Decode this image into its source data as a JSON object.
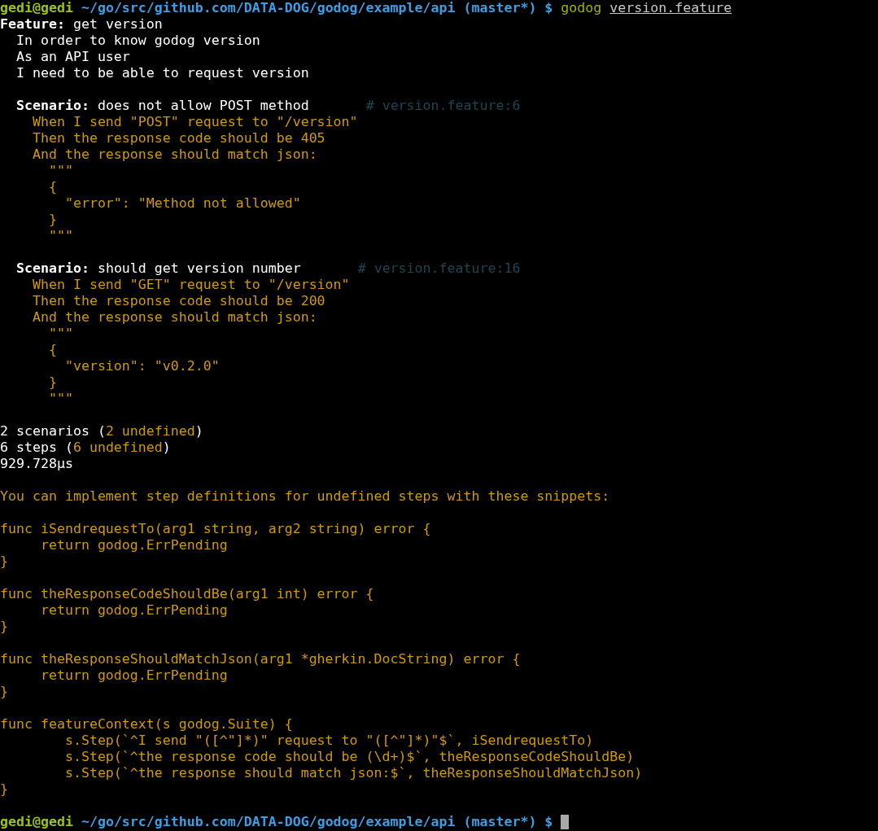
{
  "terminal": {
    "lines": [
      {
        "kind": "text",
        "segments": [
          {
            "kind": "user",
            "text": "gedi@gedi"
          },
          {
            "kind": "path",
            "text": "~/go/src/github.com/DATA-DOG/godog/example/api (master*) $"
          },
          {
            "kind": "command",
            "text": "godog"
          },
          {
            "kind": "argument",
            "text": "version.feature"
          }
        ]
      },
      {
        "kind": "text",
        "segments": [
          {
            "kind": "heading",
            "text": "**Feature:** get version"
          }
        ]
      },
      {
        "kind": "text",
        "segments": [
          {
            "kind": "plain",
            "text": "  In order to know godog version"
          }
        ]
      },
      {
        "kind": "text",
        "segments": [
          {
            "kind": "plain",
            "text": "  As an API user"
          }
        ]
      },
      {
        "kind": "text",
        "segments": [
          {
            "kind": "plain",
            "text": "  I need to be able to request version"
          }
        ]
      },
      {
        "kind": "blank"
      },
      {
        "kind": "text",
        "segments": [
          {
            "kind": "heading",
            "text": "  **Scenario:** does not allow POST method"
          },
          {
            "kind": "comment",
            "text": "# version.feature:6"
          }
        ]
      },
      {
        "kind": "text",
        "segments": [
          {
            "kind": "step",
            "text": "    When I send \"POST\" request to \"/version\""
          }
        ]
      },
      {
        "kind": "text",
        "segments": [
          {
            "kind": "step",
            "text": "    Then the response code should be 405"
          }
        ]
      },
      {
        "kind": "text",
        "segments": [
          {
            "kind": "step",
            "text": "    And the response should match json:"
          }
        ]
      },
      {
        "kind": "text",
        "segments": [
          {
            "kind": "step",
            "text": "      \"\"\""
          }
        ]
      },
      {
        "kind": "text",
        "segments": [
          {
            "kind": "step",
            "text": "      {"
          }
        ]
      },
      {
        "kind": "text",
        "segments": [
          {
            "kind": "step",
            "text": "        \"error\": \"Method not allowed\""
          }
        ]
      },
      {
        "kind": "text",
        "segments": [
          {
            "kind": "step",
            "text": "      }"
          }
        ]
      },
      {
        "kind": "text",
        "segments": [
          {
            "kind": "step",
            "text": "      \"\"\""
          }
        ]
      },
      {
        "kind": "blank"
      },
      {
        "kind": "text",
        "segments": [
          {
            "kind": "heading",
            "text": "  **Scenario:** should get version number"
          },
          {
            "kind": "comment",
            "text": "# version.feature:16"
          }
        ]
      },
      {
        "kind": "text",
        "segments": [
          {
            "kind": "step",
            "text": "    When I send \"GET\" request to \"/version\""
          }
        ]
      },
      {
        "kind": "text",
        "segments": [
          {
            "kind": "step",
            "text": "    Then the response code should be 200"
          }
        ]
      },
      {
        "kind": "text",
        "segments": [
          {
            "kind": "step",
            "text": "    And the response should match json:"
          }
        ]
      },
      {
        "kind": "text",
        "segments": [
          {
            "kind": "step",
            "text": "      \"\"\""
          }
        ]
      },
      {
        "kind": "text",
        "segments": [
          {
            "kind": "step",
            "text": "      {"
          }
        ]
      },
      {
        "kind": "text",
        "segments": [
          {
            "kind": "step",
            "text": "        \"version\": \"v0.2.0\""
          }
        ]
      },
      {
        "kind": "text",
        "segments": [
          {
            "kind": "step",
            "text": "      }"
          }
        ]
      },
      {
        "kind": "text",
        "segments": [
          {
            "kind": "step",
            "text": "      \"\"\""
          }
        ]
      },
      {
        "kind": "blank"
      },
      {
        "kind": "text",
        "segments": [
          {
            "kind": "plain",
            "text": "2 scenarios ("
          },
          {
            "kind": "undefined",
            "text": "2 undefined"
          },
          {
            "kind": "plain",
            "text": ")"
          }
        ]
      },
      {
        "kind": "text",
        "segments": [
          {
            "kind": "plain",
            "text": "6 steps ("
          },
          {
            "kind": "undefined",
            "text": "6 undefined"
          },
          {
            "kind": "plain",
            "text": ")"
          }
        ]
      },
      {
        "kind": "text",
        "segments": [
          {
            "kind": "plain",
            "text": "929.728µs"
          }
        ]
      },
      {
        "kind": "blank"
      },
      {
        "kind": "text",
        "segments": [
          {
            "kind": "snippet",
            "text": "You can implement step definitions for undefined steps with these snippets:"
          }
        ]
      },
      {
        "kind": "blank"
      },
      {
        "kind": "text",
        "segments": [
          {
            "kind": "snippet",
            "text": "func iSendrequestTo(arg1 string, arg2 string) error {"
          }
        ]
      },
      {
        "kind": "text",
        "segments": [
          {
            "kind": "snippet",
            "text": "     return godog.ErrPending"
          }
        ]
      },
      {
        "kind": "text",
        "segments": [
          {
            "kind": "snippet",
            "text": "}"
          }
        ]
      },
      {
        "kind": "blank"
      },
      {
        "kind": "text",
        "segments": [
          {
            "kind": "snippet",
            "text": "func theResponseCodeShouldBe(arg1 int) error {"
          }
        ]
      },
      {
        "kind": "text",
        "segments": [
          {
            "kind": "snippet",
            "text": "     return godog.ErrPending"
          }
        ]
      },
      {
        "kind": "text",
        "segments": [
          {
            "kind": "snippet",
            "text": "}"
          }
        ]
      },
      {
        "kind": "blank"
      },
      {
        "kind": "text",
        "segments": [
          {
            "kind": "snippet",
            "text": "func theResponseShouldMatchJson(arg1 *gherkin.DocString) error {"
          }
        ]
      },
      {
        "kind": "text",
        "segments": [
          {
            "kind": "snippet",
            "text": "     return godog.ErrPending"
          }
        ]
      },
      {
        "kind": "text",
        "segments": [
          {
            "kind": "snippet",
            "text": "}"
          }
        ]
      },
      {
        "kind": "blank"
      },
      {
        "kind": "text",
        "segments": [
          {
            "kind": "snippet",
            "text": "func featureContext(s godog.Suite) {"
          }
        ]
      },
      {
        "kind": "text",
        "segments": [
          {
            "kind": "snippet",
            "text": "        s.Step(`^I send \"([^\"]*)\" request to \"([^\"]*)\"$`, iSendrequestTo)"
          }
        ]
      },
      {
        "kind": "text",
        "segments": [
          {
            "kind": "snippet",
            "text": "        s.Step(`^the response code should be (\\d+)$`, theResponseCodeShouldBe)"
          }
        ]
      },
      {
        "kind": "text",
        "segments": [
          {
            "kind": "snippet",
            "text": "        s.Step(`^the response should match json:$`, theResponseShouldMatchJson)"
          }
        ]
      },
      {
        "kind": "text",
        "segments": [
          {
            "kind": "snippet",
            "text": "}"
          }
        ]
      },
      {
        "kind": "blank"
      },
      {
        "kind": "text",
        "segments": [
          {
            "kind": "user",
            "text": "gedi@gedi"
          },
          {
            "kind": "path",
            "text": "~/go/src/github.com/DATA-DOG/godog/example/api (master*) $"
          },
          {
            "kind": "cursor"
          }
        ]
      }
    ]
  }
}
